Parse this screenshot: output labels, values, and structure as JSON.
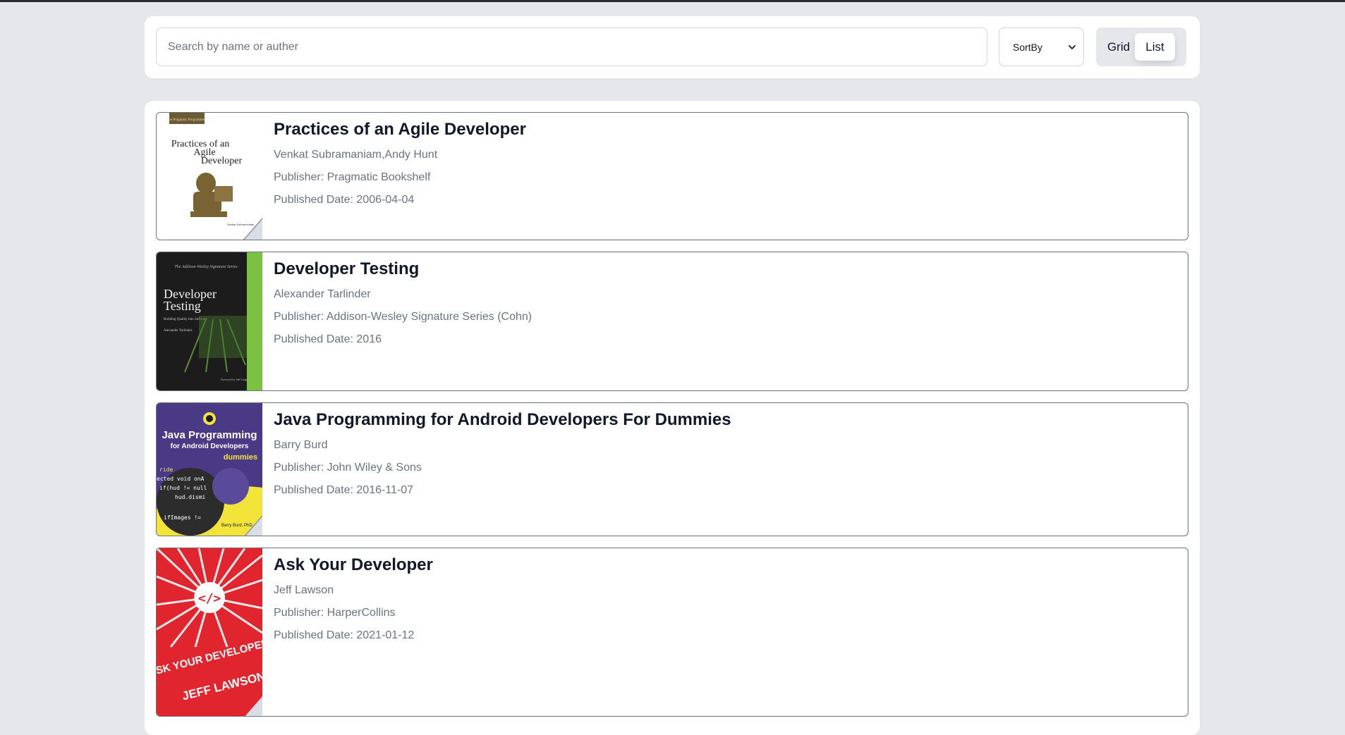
{
  "search": {
    "placeholder": "Search by name or auther"
  },
  "sort": {
    "label": "SortBy"
  },
  "view_toggle": {
    "grid_label": "Grid",
    "list_label": "List",
    "active": "List"
  },
  "books": [
    {
      "title": "Practices of an Agile Developer",
      "authors": "Venkat Subramaniam,Andy Hunt",
      "publisher": "Publisher: Pragmatic Bookshelf",
      "published": "Published Date: 2006-04-04",
      "cover_text": [
        "The Pragmatic Programmers",
        "Practices of an",
        "Agile",
        "Developer",
        "Venkat Subramaniam"
      ]
    },
    {
      "title": "Developer Testing",
      "authors": "Alexander Tarlinder",
      "publisher": "Publisher: Addison-Wesley Signature Series (Cohn)",
      "published": "Published Date: 2016",
      "cover_text": [
        "The Addison-Wesley Signature Series",
        "Developer",
        "Testing",
        "Building Quality into Software",
        "Alexander Tarlinder",
        "Foreword by Jeff Langr"
      ]
    },
    {
      "title": "Java Programming for Android Developers For Dummies",
      "authors": "Barry Burd",
      "publisher": "Publisher: John Wiley & Sons",
      "published": "Published Date: 2016-11-07",
      "cover_text": [
        "Java Programming",
        "for Android Developers",
        "dummies",
        "ride",
        "ected void onA",
        "if(hud != null",
        "hud.dismi",
        "ifImages !=",
        "Barry Burd, PhD"
      ]
    },
    {
      "title": "Ask Your Developer",
      "authors": "Jeff Lawson",
      "publisher": "Publisher: HarperCollins",
      "published": "Published Date: 2021-01-12",
      "cover_text": [
        "</>",
        "ASK YOUR DEVELOPER",
        "JEFF LAWSON"
      ]
    }
  ]
}
